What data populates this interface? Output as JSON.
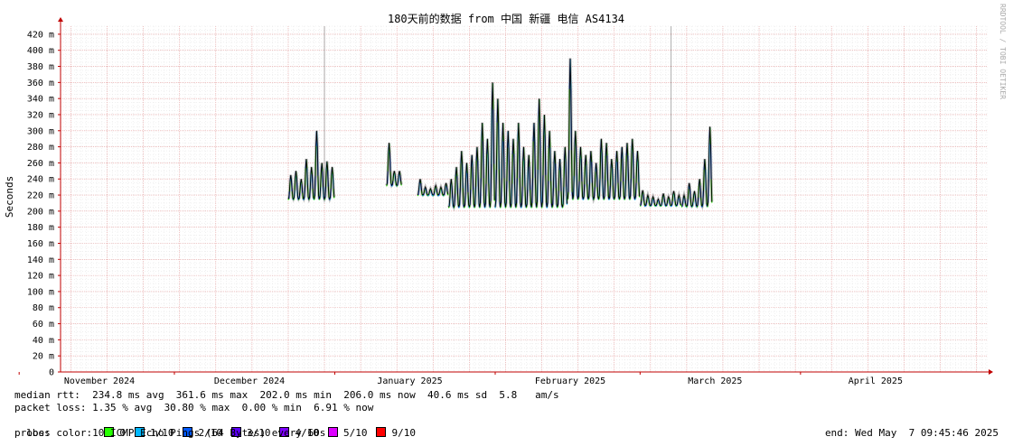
{
  "chart_data": {
    "type": "line",
    "title": "180天前的数据 from 中国 新疆 电信 AS4134",
    "watermark": "RRDTOOL / TOBI OETIKER",
    "ylabel": "Seconds",
    "ylim": [
      0,
      0.43
    ],
    "y_ticks": [
      {
        "v": 0,
        "label": "0"
      },
      {
        "v": 0.02,
        "label": "20 m"
      },
      {
        "v": 0.04,
        "label": "40 m"
      },
      {
        "v": 0.06,
        "label": "60 m"
      },
      {
        "v": 0.08,
        "label": "80 m"
      },
      {
        "v": 0.1,
        "label": "100 m"
      },
      {
        "v": 0.12,
        "label": "120 m"
      },
      {
        "v": 0.14,
        "label": "140 m"
      },
      {
        "v": 0.16,
        "label": "160 m"
      },
      {
        "v": 0.18,
        "label": "180 m"
      },
      {
        "v": 0.2,
        "label": "200 m"
      },
      {
        "v": 0.22,
        "label": "220 m"
      },
      {
        "v": 0.24,
        "label": "240 m"
      },
      {
        "v": 0.26,
        "label": "260 m"
      },
      {
        "v": 0.28,
        "label": "280 m"
      },
      {
        "v": 0.3,
        "label": "300 m"
      },
      {
        "v": 0.32,
        "label": "320 m"
      },
      {
        "v": 0.34,
        "label": "340 m"
      },
      {
        "v": 0.36,
        "label": "360 m"
      },
      {
        "v": 0.38,
        "label": "380 m"
      },
      {
        "v": 0.4,
        "label": "400 m"
      },
      {
        "v": 0.42,
        "label": "420 m"
      }
    ],
    "x_domain": [
      "2024-11-09",
      "2025-05-07"
    ],
    "x_ticks": [
      {
        "date": "2024-11-01",
        "label": "November 2024"
      },
      {
        "date": "2024-12-01",
        "label": "December 2024"
      },
      {
        "date": "2025-01-01",
        "label": "January 2025"
      },
      {
        "date": "2025-02-01",
        "label": "February 2025"
      },
      {
        "date": "2025-03-01",
        "label": "March 2025"
      },
      {
        "date": "2025-04-01",
        "label": "April 2025"
      }
    ],
    "grid": true,
    "segments": [
      {
        "start": "2024-12-23",
        "end": "2024-12-31",
        "base": 0.215,
        "peak": 0.262,
        "daily_max": [
          0.245,
          0.25,
          0.24,
          0.265,
          0.255,
          0.3,
          0.26,
          0.262,
          0.255
        ]
      },
      {
        "start": "2025-01-11",
        "end": "2025-01-13",
        "base": 0.232,
        "peak": 0.25,
        "daily_max": [
          0.285,
          0.25,
          0.25
        ]
      },
      {
        "start": "2025-01-17",
        "end": "2025-01-22",
        "base": 0.22,
        "peak": 0.232,
        "daily_max": [
          0.24,
          0.23,
          0.228,
          0.232,
          0.23,
          0.235
        ]
      },
      {
        "start": "2025-01-23",
        "end": "2025-01-31",
        "base": 0.205,
        "peak": 0.28,
        "daily_max": [
          0.24,
          0.255,
          0.275,
          0.26,
          0.27,
          0.28,
          0.31,
          0.29,
          0.36
        ]
      },
      {
        "start": "2025-02-01",
        "end": "2025-02-14",
        "base": 0.205,
        "peak": 0.31,
        "daily_max": [
          0.34,
          0.31,
          0.3,
          0.29,
          0.31,
          0.28,
          0.27,
          0.31,
          0.34,
          0.32,
          0.3,
          0.275,
          0.265,
          0.28
        ]
      },
      {
        "start": "2025-02-15",
        "end": "2025-02-28",
        "base": 0.215,
        "peak": 0.29,
        "daily_max": [
          0.39,
          0.3,
          0.28,
          0.27,
          0.275,
          0.26,
          0.29,
          0.285,
          0.265,
          0.275,
          0.28,
          0.285,
          0.29,
          0.275
        ]
      },
      {
        "start": "2025-03-01",
        "end": "2025-03-08",
        "base": 0.207,
        "peak": 0.225,
        "daily_max": [
          0.226,
          0.22,
          0.218,
          0.215,
          0.222,
          0.218,
          0.225,
          0.22
        ]
      },
      {
        "start": "2025-03-09",
        "end": "2025-03-14",
        "base": 0.206,
        "peak": 0.27,
        "daily_max": [
          0.22,
          0.235,
          0.225,
          0.24,
          0.265,
          0.305
        ]
      }
    ],
    "spikes": [
      {
        "date": "2024-12-30",
        "value": 0.43
      },
      {
        "date": "2025-03-07",
        "value": 0.43
      }
    ],
    "loss_colors": [
      {
        "label": "0",
        "color": "#26ff00"
      },
      {
        "label": "1/10",
        "color": "#00b8ff"
      },
      {
        "label": "2/10",
        "color": "#0059ff"
      },
      {
        "label": "3/10",
        "color": "#5e00ff"
      },
      {
        "label": "4/10",
        "color": "#7e00ff"
      },
      {
        "label": "5/10",
        "color": "#dd00ff"
      },
      {
        "label": "9/10",
        "color": "#ff0000"
      }
    ],
    "line_color": "#000000"
  },
  "stats": {
    "median_rtt": "median rtt:  234.8 ms avg  361.6 ms max  202.0 ms min  206.0 ms now  40.6 ms sd  5.8   am/s",
    "packet_loss": "packet loss: 1.35 % avg  30.80 % max  0.00 % min  6.91 % now",
    "loss_color_label": "loss color:",
    "probe": "probe:       10 ICMP Echo Pings (64 Bytes) every 60s",
    "end": "end: Wed May  7 09:45:46 2025"
  }
}
